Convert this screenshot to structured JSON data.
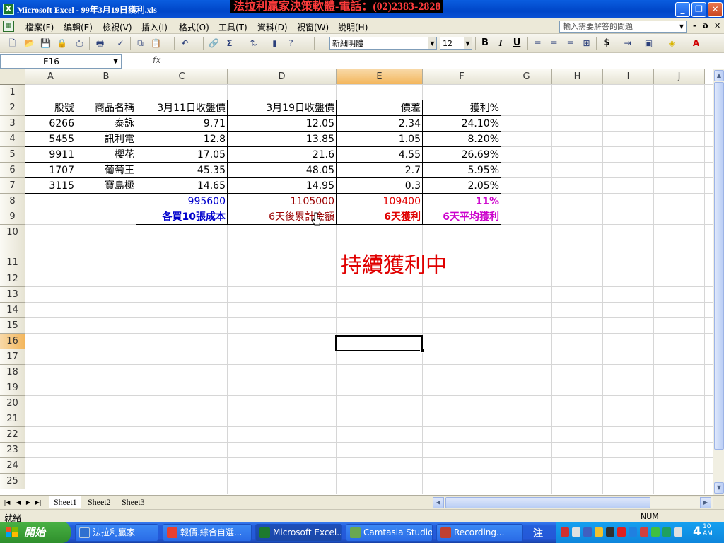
{
  "window": {
    "title": "Microsoft Excel - 99年3月19日獲利.xls",
    "banner": "法拉利贏家決策軟體-電話：(02)2383-2828",
    "minimize": "_",
    "restore": "❐",
    "close": "✕"
  },
  "menu": {
    "items": [
      "檔案(F)",
      "編輯(E)",
      "檢視(V)",
      "插入(I)",
      "格式(O)",
      "工具(T)",
      "資料(D)",
      "視窗(W)",
      "說明(H)"
    ],
    "help_placeholder": "輸入需要解答的問題",
    "mdi_min": "-",
    "mdi_restore": "ð",
    "mdi_close": "✕"
  },
  "toolbar": {
    "font_name": "新細明體",
    "font_size": "12",
    "bold": "B",
    "italic": "I",
    "underline": "U",
    "sigma": "Σ",
    "currency": "$"
  },
  "formula_bar": {
    "name_box": "E16",
    "fx": "fx",
    "content": ""
  },
  "sheet": {
    "columns": [
      "A",
      "B",
      "C",
      "D",
      "E",
      "F",
      "G",
      "H",
      "I",
      "J"
    ],
    "active_column": "E",
    "active_row": "16",
    "rows": [
      "1",
      "2",
      "3",
      "4",
      "5",
      "6",
      "7",
      "8",
      "9",
      "10",
      "11",
      "12",
      "13",
      "14",
      "15",
      "16",
      "17",
      "18",
      "19",
      "20",
      "21",
      "22",
      "23",
      "24",
      "25"
    ],
    "headers": [
      "股號",
      "商品名稱",
      "3月11日收盤價",
      "3月19日收盤價",
      "價差",
      "獲利%"
    ],
    "data_rows": [
      [
        "6266",
        "泰詠",
        "9.71",
        "12.05",
        "2.34",
        "24.10%"
      ],
      [
        "5455",
        "訊利電",
        "12.8",
        "13.85",
        "1.05",
        "8.20%"
      ],
      [
        "9911",
        "櫻花",
        "17.05",
        "21.6",
        "4.55",
        "26.69%"
      ],
      [
        "1707",
        "葡萄王",
        "45.35",
        "48.05",
        "2.7",
        "5.95%"
      ],
      [
        "3115",
        "寶島極",
        "14.65",
        "14.95",
        "0.3",
        "2.05%"
      ]
    ],
    "totals": {
      "c8": "995600",
      "d8": "1105000",
      "e8": "109400",
      "f8": "11%",
      "c9": "各買10張成本",
      "d9": "6天後累計金額",
      "e9": "6天獲利",
      "f9": "6天平均獲利"
    },
    "big_text": "持續獲利中"
  },
  "colors": {
    "blue_text": "#0000cc",
    "darkred_text": "#990000",
    "red_text": "#e00000",
    "magenta_text": "#cc00cc"
  },
  "sheet_tabs": [
    "Sheet1",
    "Sheet2",
    "Sheet3"
  ],
  "status": {
    "ready": "就緒",
    "num": "NUM"
  },
  "taskbar": {
    "start": "開始",
    "tasks": [
      "法拉利贏家",
      "報價.綜合自選...",
      "Microsoft Excel...",
      "Camtasia Studio...",
      "Recording..."
    ],
    "ime": "注",
    "clock_hour": "4",
    "clock_min": "10",
    "clock_ampm": "AM"
  }
}
